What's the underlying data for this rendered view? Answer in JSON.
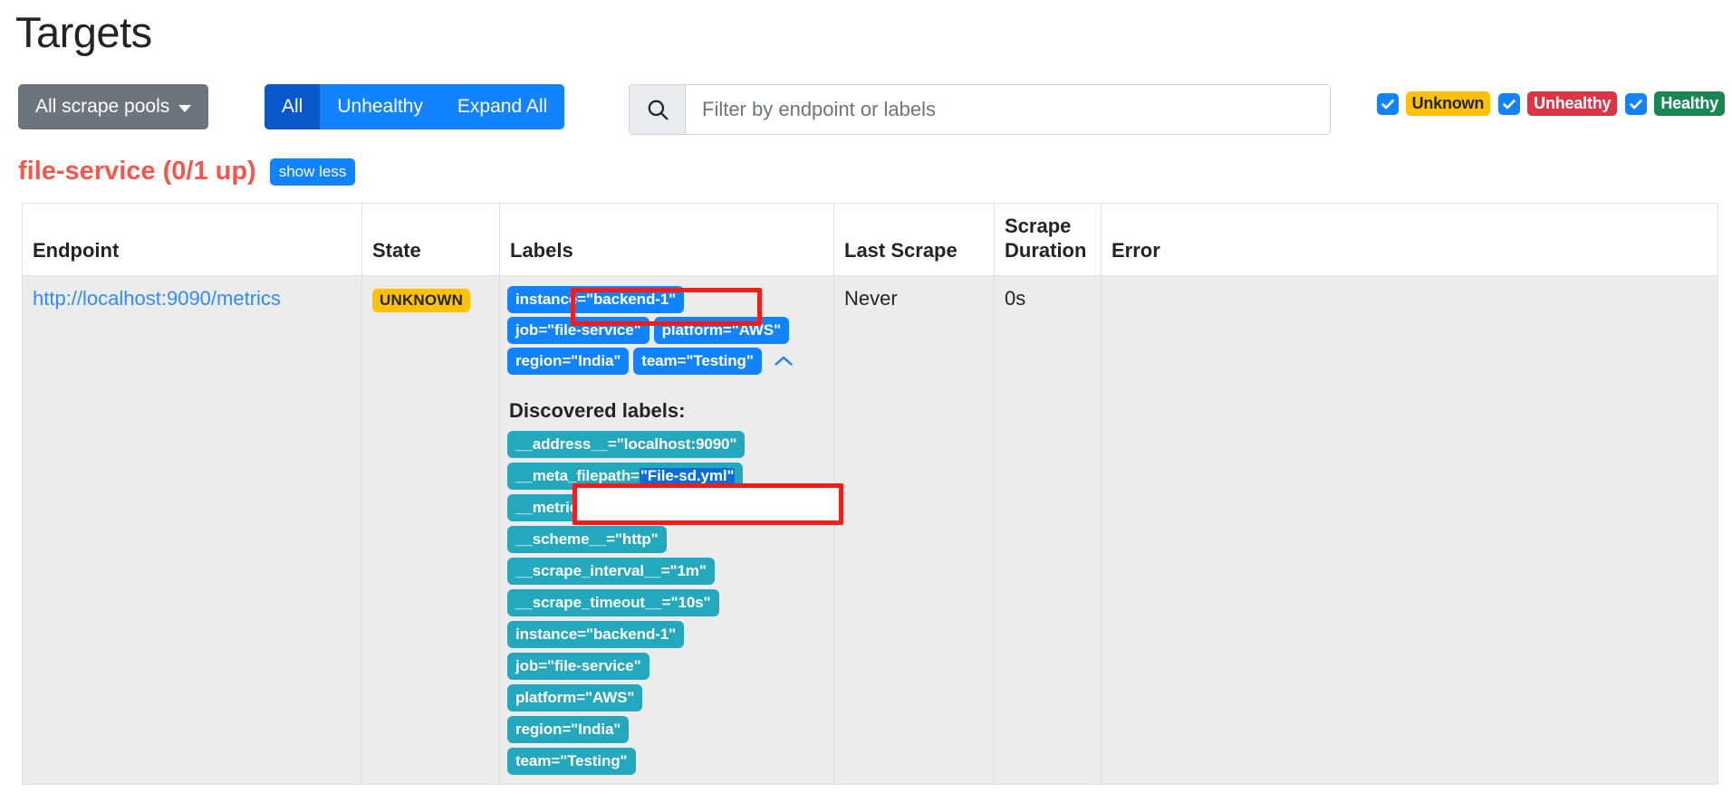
{
  "page": {
    "title": "Targets"
  },
  "toolbar": {
    "scrape_pools_label": "All scrape pools",
    "filter_buttons": [
      {
        "label": "All",
        "active": true
      },
      {
        "label": "Unhealthy",
        "active": false
      },
      {
        "label": "Expand All",
        "active": false
      }
    ],
    "search": {
      "placeholder": "Filter by endpoint or labels",
      "value": "",
      "icon": "search-icon"
    },
    "status_filters": [
      {
        "label": "Unknown",
        "checked": true,
        "color": "#ffc107",
        "text_color": "#212529"
      },
      {
        "label": "Unhealthy",
        "checked": true,
        "color": "#dc3545",
        "text_color": "#ffffff"
      },
      {
        "label": "Healthy",
        "checked": true,
        "color": "#198754",
        "text_color": "#ffffff"
      }
    ]
  },
  "scrape_pool": {
    "title": "file-service (0/1 up)",
    "title_color": "#f5564e",
    "toggle_label": "show less"
  },
  "table": {
    "headers": [
      "Endpoint",
      "State",
      "Labels",
      "Last Scrape",
      "Scrape Duration",
      "Error"
    ],
    "rows": [
      {
        "endpoint": "http://localhost:9090/metrics",
        "state": "UNKNOWN",
        "state_color": "#ffc107",
        "labels": [
          "instance=\"backend-1\"",
          "job=\"file-service\"",
          "platform=\"AWS\"",
          "region=\"India\"",
          "team=\"Testing\""
        ],
        "collapse_icon": "chevron-up-icon",
        "discovered_title": "Discovered labels:",
        "discovered_labels": [
          {
            "text": "__address__=\"localhost:9090\""
          },
          {
            "text": "__meta_filepath=\"File-sd.yml\"",
            "prefix": "__meta_filepath=",
            "selected": "\"File-sd.yml\""
          },
          {
            "text": "__metrics_path__=\"/metrics\""
          },
          {
            "text": "__scheme__=\"http\""
          },
          {
            "text": "__scrape_interval__=\"1m\""
          },
          {
            "text": "__scrape_timeout__=\"10s\""
          },
          {
            "text": "instance=\"backend-1\""
          },
          {
            "text": "job=\"file-service\""
          },
          {
            "text": "platform=\"AWS\""
          },
          {
            "text": "region=\"India\""
          },
          {
            "text": "team=\"Testing\""
          }
        ],
        "last_scrape": "Never",
        "scrape_duration": "0s",
        "error": ""
      }
    ]
  },
  "annotations": [
    {
      "name": "highlight-instance-label",
      "color": "#f41c19"
    },
    {
      "name": "highlight-meta-filepath-label",
      "color": "#f41c19"
    }
  ]
}
